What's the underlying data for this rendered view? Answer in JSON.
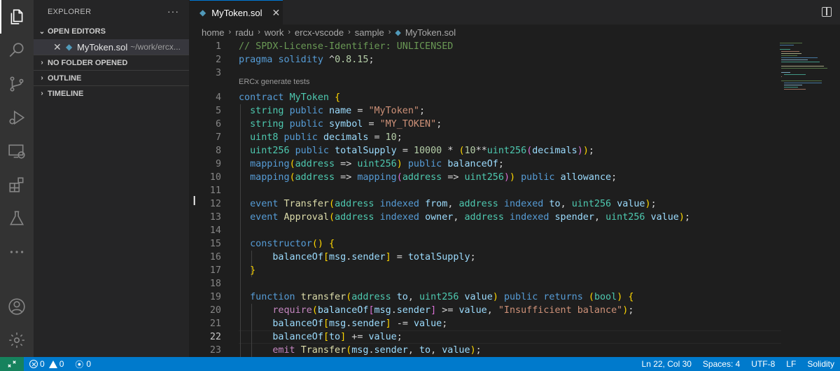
{
  "activity_bar": {
    "items": [
      {
        "name": "explorer-icon",
        "active": true
      },
      {
        "name": "search-icon"
      },
      {
        "name": "source-control-icon"
      },
      {
        "name": "run-debug-icon"
      },
      {
        "name": "remote-explorer-icon"
      },
      {
        "name": "extensions-icon"
      },
      {
        "name": "testing-icon"
      },
      {
        "name": "more-icon"
      },
      {
        "name": "account-icon"
      },
      {
        "name": "settings-gear-icon"
      }
    ]
  },
  "sidebar": {
    "title": "EXPLORER",
    "more": "···",
    "sections": {
      "open_editors": "OPEN EDITORS",
      "no_folder": "NO FOLDER OPENED",
      "outline": "OUTLINE",
      "timeline": "TIMELINE"
    },
    "open_file": {
      "name": "MyToken.sol",
      "path": "~/work/ercx..."
    }
  },
  "tab": {
    "label": "MyToken.sol"
  },
  "breadcrumb": [
    "home",
    "radu",
    "work",
    "ercx-vscode",
    "sample",
    "MyToken.sol"
  ],
  "editor": {
    "codelens": "ERCx generate tests",
    "current_line": 22,
    "lines": [
      "// SPDX-License-Identifier: UNLICENSED",
      "pragma solidity ^0.8.15;",
      "",
      "contract MyToken {",
      "  string public name = \"MyToken\";",
      "  string public symbol = \"MY_TOKEN\";",
      "  uint8 public decimals = 10;",
      "  uint256 public totalSupply = 10000 * (10**uint256(decimals));",
      "  mapping(address => uint256) public balanceOf;",
      "  mapping(address => mapping(address => uint256)) public allowance;",
      "",
      "  event Transfer(address indexed from, address indexed to, uint256 value);",
      "  event Approval(address indexed owner, address indexed spender, uint256 value);",
      "",
      "  constructor() {",
      "      balanceOf[msg.sender] = totalSupply;",
      "  }",
      "",
      "  function transfer(address to, uint256 value) public returns (bool) {",
      "      require(balanceOf[msg.sender] >= value, \"Insufficient balance\");",
      "      balanceOf[msg.sender] -= value;",
      "      balanceOf[to] += value;",
      "      emit Transfer(msg.sender, to, value);"
    ]
  },
  "statusbar": {
    "errors": "0",
    "warnings": "0",
    "ports": "0",
    "position": "Ln 22, Col 30",
    "spaces": "Spaces: 4",
    "encoding": "UTF-8",
    "eol": "LF",
    "language": "Solidity"
  }
}
